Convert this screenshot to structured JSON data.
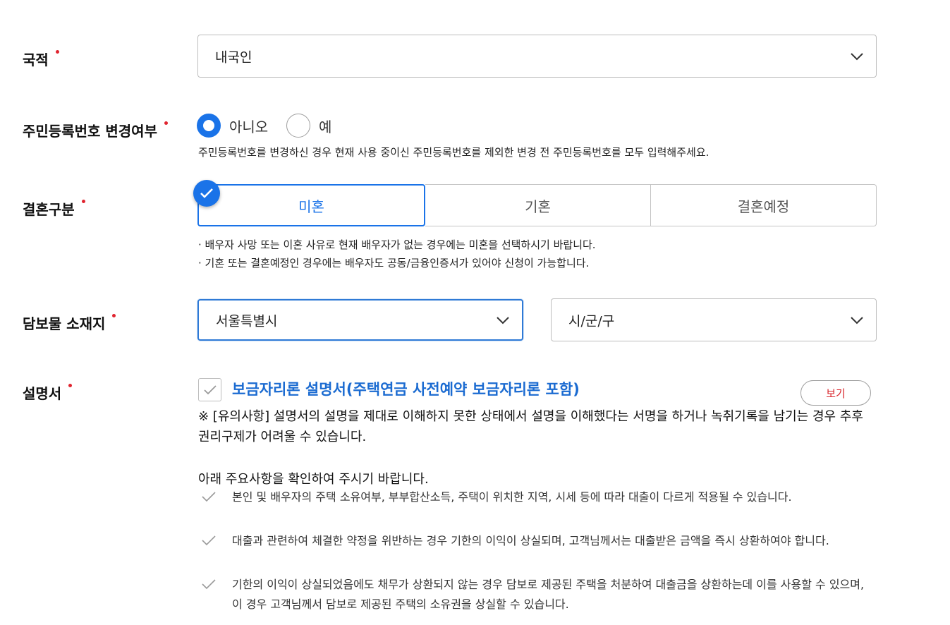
{
  "nationality": {
    "label": "국적",
    "value": "내국인"
  },
  "id_change": {
    "label": "주민등록번호 변경여부",
    "options": [
      "아니오",
      "예"
    ],
    "selected": "아니오",
    "help": "주민등록번호를 변경하신 경우 현재 사용 중이신 주민등록번호를 제외한 변경 전 주민등록번호를 모두 입력해주세요."
  },
  "marriage": {
    "label": "결혼구분",
    "options": [
      "미혼",
      "기혼",
      "결혼예정"
    ],
    "selected": "미혼",
    "notes": [
      "· 배우자 사망 또는 이혼 사유로 현재 배우자가 없는 경우에는 미혼을 선택하시기 바랍니다.",
      "· 기혼 또는 결혼예정인 경우에는 배우자도 공동/금융인증서가 있어야 신청이 가능합니다."
    ]
  },
  "collateral": {
    "label": "담보물 소재지",
    "city_value": "서울특별시",
    "district_value": "시/군/구"
  },
  "explanation": {
    "label": "설명서",
    "doc_title": "보금자리론 설명서(주택연금 사전예약 보금자리론 포함)",
    "view_label": "보기",
    "notice": "※ [유의사항] 설명서의 설명을 제대로 이해하지 못한 상태에서 설명을 이해했다는 서명을 하거나 녹취기록을 남기는 경우 추후 권리구제가 어려울 수 있습니다.",
    "sub_head": "아래 주요사항을 확인하여 주시기 바랍니다.",
    "items": [
      "본인 및 배우자의 주택 소유여부, 부부합산소득, 주택이 위치한 지역, 시세 등에 따라 대출이 다르게 적용될 수 있습니다.",
      "대출과 관련하여 체결한 약정을 위반하는 경우 기한의 이익이 상실되며, 고객님께서는 대출받은 금액을 즉시 상환하여야 합니다.",
      "기한의 이익이 상실되었음에도 채무가 상환되지 않는 경우 담보로 제공된 주택을 처분하여 대출금을 상환하는데 이를 사용할 수 있으며, 이 경우 고객님께서 담보로 제공된 주택의 소유권을 상실할 수 있습니다."
    ]
  },
  "colors": {
    "accent": "#1a73e8",
    "required": "#e0242f",
    "link": "#1b6bd1"
  },
  "icons": {
    "dropdown": "chevron-down-icon",
    "selected_badge": "check-icon",
    "list_bullet": "check-icon"
  }
}
